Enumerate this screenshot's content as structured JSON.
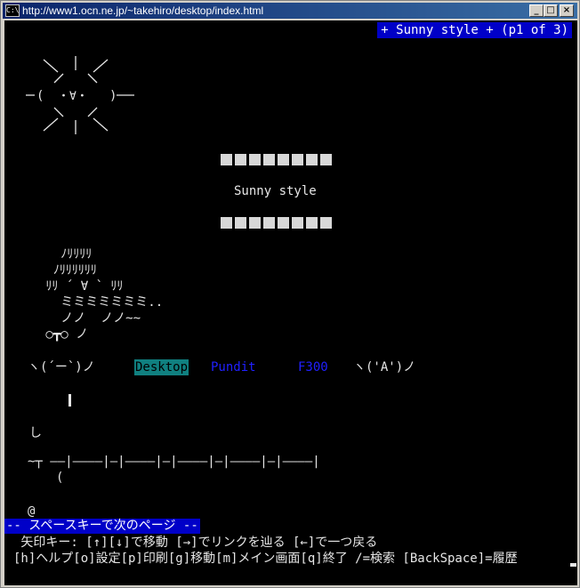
{
  "window": {
    "icon_label": "C:\\",
    "title": "http://www1.ocn.ne.jp/~takehiro/desktop/index.html",
    "minimize_icon": "minimize-icon",
    "maximize_icon": "maximize-icon",
    "close_icon": "close-icon"
  },
  "page": {
    "header": "+ Sunny style + (p1 of 3)",
    "sun_art": [
      "  ＼  |  ／",
      "",
      "―(  ・∀・  )―",
      "",
      "  ／  |  ＼"
    ],
    "title": "Sunny style",
    "character_art": [
      "   ﾉﾘﾘﾘﾘ",
      "  ﾉﾘﾘﾘﾘﾘﾘ",
      " ﾘﾘ ´ ∀ ` ﾘﾘ",
      "   ミミミミミミミ..",
      "   ノノ  ノノ~~",
      " ○┳○ ノ"
    ],
    "nav_left_emote": "ヽ(´ー`)ノ",
    "nav_links": [
      "Desktop",
      "Pundit",
      "F300"
    ],
    "nav_right_emote": "ヽ('A')ノ",
    "misc_shi": "し",
    "fence_line": "~┬ ――|――――|―|――――|―|――――|―|――――|―|――――|",
    "paren": "(",
    "at_mark": "@"
  },
  "status": {
    "more_prompt": "-- スペースキーで次のページ --",
    "help_line1": " 矢印キー: [↑][↓]で移動 [→]でリンクを辿る [←]で一つ戻る",
    "help_line2": "[h]ヘルプ[o]設定[p]印刷[g]移動[m]メイン画面[q]終了 /=検索 [BackSpace]=履歴"
  }
}
